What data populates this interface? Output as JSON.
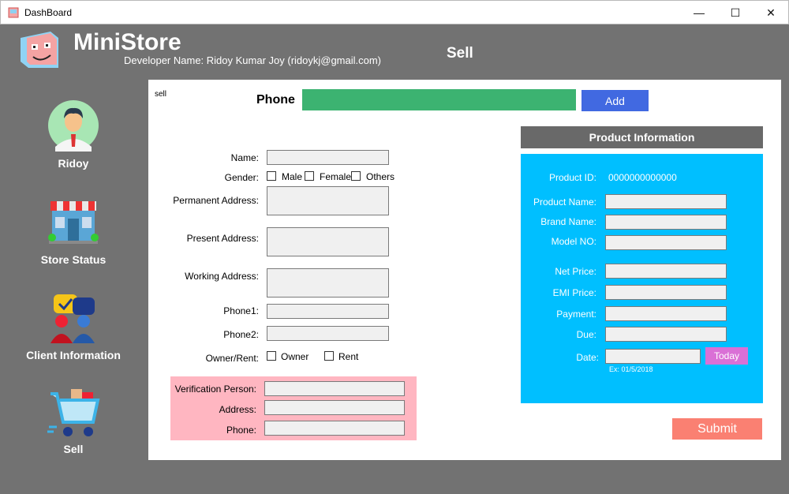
{
  "window": {
    "title": "DashBoard",
    "minimize": "—",
    "maximize": "☐",
    "close": "✕"
  },
  "header": {
    "brand": "MiniStore",
    "developer": "Developer Name: Ridoy Kumar Joy (ridoykj@gmail.com)",
    "page_title": "Sell"
  },
  "sidebar": {
    "items": [
      {
        "label": "Ridoy",
        "icon": "user-avatar-icon"
      },
      {
        "label": "Store Status",
        "icon": "store-icon"
      },
      {
        "label": "Client Information",
        "icon": "client-chat-icon"
      },
      {
        "label": "Sell",
        "icon": "shopping-cart-icon"
      }
    ]
  },
  "main": {
    "tag": "sell",
    "phone_label": "Phone",
    "phone_value": "",
    "add_button": "Add",
    "customer": {
      "name_label": "Name:",
      "gender_label": "Gender:",
      "gender_options": [
        "Male",
        "Female",
        "Others"
      ],
      "permanent_address_label": "Permanent Address:",
      "present_address_label": "Present Address:",
      "working_address_label": "Working Address:",
      "phone1_label": "Phone1:",
      "phone2_label": "Phone2:",
      "owner_rent_label": "Owner/Rent:",
      "owner_rent_options": [
        "Owner",
        "Rent"
      ]
    },
    "verification": {
      "person_label": "Verification Person:",
      "address_label": "Address:",
      "phone_label": "Phone:"
    },
    "product": {
      "header": "Product Information",
      "product_id_label": "Product ID:",
      "product_id_value": "0000000000000",
      "product_name_label": "Product Name:",
      "brand_name_label": "Brand Name:",
      "model_no_label": "Model NO:",
      "net_price_label": "Net Price:",
      "emi_price_label": "EMI Price:",
      "payment_label": "Payment:",
      "due_label": "Due:",
      "date_label": "Date:",
      "today_button": "Today",
      "date_hint": "Ex: 01/5/2018"
    },
    "submit_button": "Submit"
  },
  "colors": {
    "background": "#727272",
    "phone_field": "#3cb371",
    "add_button": "#4169e1",
    "product_header": "#696969",
    "product_panel": "#00bfff",
    "today_button": "#da70d6",
    "submit_button": "#fa8072",
    "verification_panel": "#ffb6c1"
  }
}
